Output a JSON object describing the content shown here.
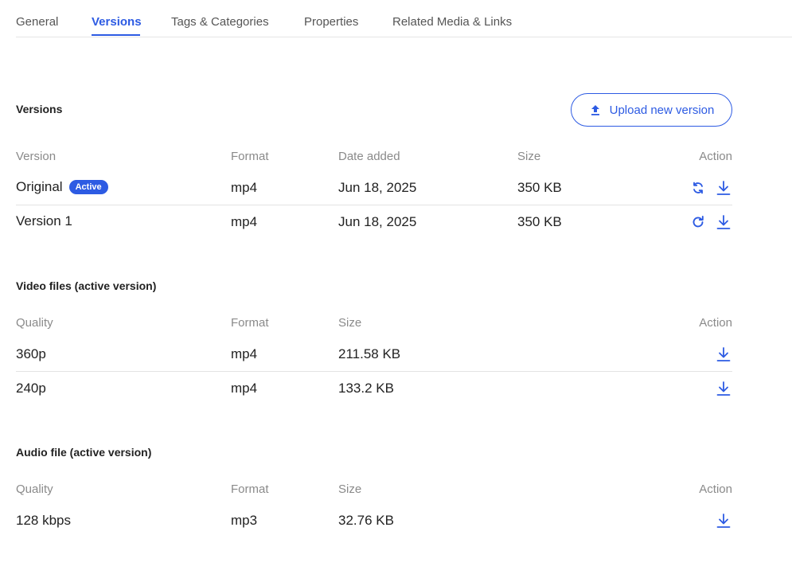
{
  "tabs": [
    "General",
    "Versions",
    "Tags & Categories",
    "Properties",
    "Related Media & Links"
  ],
  "active_tab": "Versions",
  "accent_color": "#2d5be3",
  "versions": {
    "title": "Versions",
    "upload_label": "Upload new version",
    "columns": [
      "Version",
      "Format",
      "Date added",
      "Size",
      "Action"
    ],
    "rows": [
      {
        "version": "Original",
        "badge": "Active",
        "format": "mp4",
        "date": "Jun 18, 2025",
        "size": "350 KB",
        "actions": [
          "sync-icon",
          "download-icon"
        ]
      },
      {
        "version": "Version 1",
        "format": "mp4",
        "date": "Jun 18, 2025",
        "size": "350 KB",
        "actions": [
          "restore-icon",
          "download-icon"
        ]
      }
    ]
  },
  "video_files": {
    "title": "Video files (active version)",
    "columns": [
      "Quality",
      "Format",
      "Size",
      "Action"
    ],
    "rows": [
      {
        "quality": "360p",
        "format": "mp4",
        "size": "211.58 KB"
      },
      {
        "quality": "240p",
        "format": "mp4",
        "size": "133.2 KB"
      }
    ]
  },
  "audio_file": {
    "title": "Audio file (active version)",
    "columns": [
      "Quality",
      "Format",
      "Size",
      "Action"
    ],
    "rows": [
      {
        "quality": "128 kbps",
        "format": "mp3",
        "size": "32.76 KB"
      }
    ]
  }
}
